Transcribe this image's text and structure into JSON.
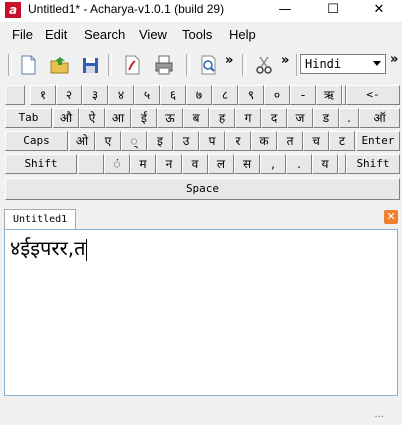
{
  "window": {
    "title": "Untitled1* - Acharya-v1.0.1 (build 29)",
    "icon_letter": "a",
    "minimize": "—",
    "maximize": "☐",
    "close": "✕"
  },
  "menu": [
    "File",
    "Edit",
    "Search",
    "View",
    "Tools",
    "Help"
  ],
  "toolbar": {
    "icons": [
      "new-file-icon",
      "open-folder-icon",
      "save-icon",
      "pdf-icon",
      "print-icon",
      "find-icon",
      "cut-icon"
    ],
    "overflow": "»",
    "language": "Hindi"
  },
  "keyboard": {
    "row1": [
      "",
      "१",
      "२",
      "३",
      "४",
      "५",
      "६",
      "७",
      "८",
      "९",
      "०",
      "-",
      "ऋ",
      "",
      "<-"
    ],
    "row2": [
      "Tab",
      "औ",
      "ऐ",
      "आ",
      "ई",
      "ऊ",
      "ब",
      "ह",
      "ग",
      "द",
      "ज",
      "ड",
      ".",
      "ऑ"
    ],
    "row3": [
      "Caps",
      "ओ",
      "ए",
      "्",
      "इ",
      "उ",
      "प",
      "र",
      "क",
      "त",
      "च",
      "ट",
      "Enter"
    ],
    "row4": [
      "Shift",
      "",
      "ं",
      "म",
      "न",
      "व",
      "ल",
      "स",
      ",",
      ".",
      "य",
      "",
      "Shift"
    ],
    "space": "Space"
  },
  "tabs": [
    {
      "label": "Untitled1"
    }
  ],
  "tab_close": "✕",
  "editor": {
    "text": "४ईइपरर,त"
  },
  "statusbar": {
    "grip": "..."
  },
  "colors": {
    "tab_close": "#f08030",
    "app_icon": "#c8102e"
  }
}
